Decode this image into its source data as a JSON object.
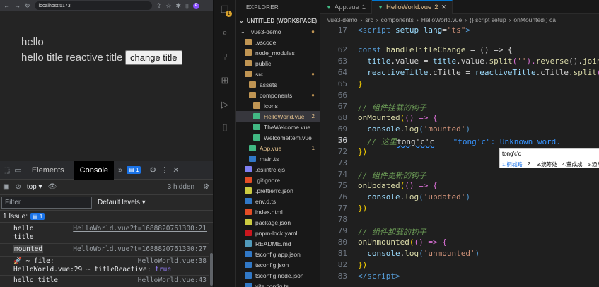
{
  "browser": {
    "url": "localhost:5173",
    "profile_letter": "P",
    "page": {
      "line1": "hello",
      "line2": "hello title reactive title",
      "button_label": "change title"
    }
  },
  "devtools": {
    "tabs": [
      "Elements",
      "Console"
    ],
    "active_tab": "Console",
    "issue_badge": "1",
    "context": "top",
    "hidden_count": "3 hidden",
    "filter_placeholder": "Filter",
    "levels": "Default levels ▾",
    "issues_label": "1 Issue:",
    "issues_count": "1",
    "logs": [
      {
        "msg1": "hello",
        "msg2": "title",
        "src": "HelloWorld.vue?t=1688820761300:21"
      },
      {
        "msg1": "mounted",
        "src": "HelloWorld.vue?t=1688820761300:27"
      },
      {
        "msg1": "🚀 ~ file:",
        "msg2": "HelloWorld.vue:29 ~ titleReactive:",
        "value": "true",
        "src": "HelloWorld.vue:38"
      },
      {
        "msg1": "hello title",
        "src": "HelloWorld.vue:43"
      }
    ]
  },
  "vscode": {
    "explorer_title": "EXPLORER",
    "workspace": "UNTITLED (WORKSPACE)",
    "notification_count": "1",
    "tree": [
      {
        "name": "vue3-demo",
        "kind": "root",
        "status": "●"
      },
      {
        "name": ".vscode",
        "kind": "folder"
      },
      {
        "name": "node_modules",
        "kind": "folder"
      },
      {
        "name": "public",
        "kind": "folder"
      },
      {
        "name": "src",
        "kind": "folder",
        "status": "●"
      },
      {
        "name": "assets",
        "kind": "folder"
      },
      {
        "name": "components",
        "kind": "folder",
        "status": "●"
      },
      {
        "name": "icons",
        "kind": "folder"
      },
      {
        "name": "HelloWorld.vue",
        "kind": "vue",
        "status": "2",
        "selected": true
      },
      {
        "name": "TheWelcome.vue",
        "kind": "vue"
      },
      {
        "name": "WelcomeItem.vue",
        "kind": "vue"
      },
      {
        "name": "App.vue",
        "kind": "vue",
        "status": "1"
      },
      {
        "name": "main.ts",
        "kind": "ts"
      },
      {
        "name": ".eslintrc.cjs",
        "kind": "eslint"
      },
      {
        "name": ".gitignore",
        "kind": "git"
      },
      {
        "name": ".prettierrc.json",
        "kind": "json"
      },
      {
        "name": "env.d.ts",
        "kind": "ts"
      },
      {
        "name": "index.html",
        "kind": "html"
      },
      {
        "name": "package.json",
        "kind": "json"
      },
      {
        "name": "pnpm-lock.yaml",
        "kind": "yaml"
      },
      {
        "name": "README.md",
        "kind": "md"
      },
      {
        "name": "tsconfig.app.json",
        "kind": "ts"
      },
      {
        "name": "tsconfig.json",
        "kind": "ts"
      },
      {
        "name": "tsconfig.node.json",
        "kind": "ts"
      },
      {
        "name": "vite.config.ts",
        "kind": "ts"
      }
    ],
    "tabs": [
      {
        "name": "App.vue",
        "status": "1"
      },
      {
        "name": "HelloWorld.vue",
        "status": "2",
        "active": true
      }
    ],
    "breadcrumb": [
      "vue3-demo",
      "src",
      "components",
      "HelloWorld.vue",
      "{} script setup",
      "onMounted() ca"
    ],
    "line_numbers": [
      "17",
      "",
      "62",
      "63",
      "64",
      "65",
      "66",
      "67",
      "68",
      "69",
      "70",
      "56",
      "72",
      "73",
      "74",
      "75",
      "76",
      "77",
      "78",
      "79",
      "80",
      "81",
      "82"
    ],
    "current_line": "56",
    "code": {
      "l1_a": "<",
      "l1_b": "script",
      "l1_c": " setup",
      "l1_d": " lang",
      "l1_e": "=",
      "l1_f": "\"ts\"",
      "l1_g": ">",
      "l3_a": "const",
      "l3_b": " handleTitleChange",
      "l3_c": " = () => {",
      "l4_a": "title",
      "l4_b": ".value = ",
      "l4_c": "title",
      "l4_d": ".value.",
      "l4_e": "split",
      "l4_f": "(",
      "l4_g": "''",
      "l4_h": ").",
      "l4_i": "reverse",
      "l4_j": "().",
      "l4_k": "join",
      "l5_a": "reactiveTitle",
      "l5_b": ".cTitle = ",
      "l5_c": "reactiveTitle",
      "l5_d": ".cTitle.",
      "l5_e": "split",
      "l5_f": "(",
      "l6": "}",
      "l8": "// 组件挂载的钩子",
      "l9_a": "onMounted",
      "l9_b": "(",
      "l9_c": "() => {",
      "l10_a": "console",
      "l10_b": ".",
      "l10_c": "log",
      "l10_d": "(",
      "l10_e": "'mounted'",
      "l10_f": ")",
      "l11_a": "// 这里",
      "l11_b": "tong'c'c",
      "l11_hint": "\"tong'c\": Unknown word.",
      "l12": "})",
      "l14": "// 组件更新的钩子",
      "l15_a": "onUpdated",
      "l15_b": "(",
      "l15_c": "() => {",
      "l16_a": "console",
      "l16_b": ".",
      "l16_c": "log",
      "l16_d": "(",
      "l16_e": "'updated'",
      "l16_f": ")",
      "l17": "})",
      "l19": "// 组件卸载的钩子",
      "l20_a": "onUnmounted",
      "l20_b": "(",
      "l20_c": "() => {",
      "l21_a": "console",
      "l21_b": ".",
      "l21_c": "log",
      "l21_d": "(",
      "l21_e": "'unmounted'",
      "l21_f": ")",
      "l22": "})",
      "l23_a": "</",
      "l23_b": "script",
      "l23_c": ">"
    },
    "ime": {
      "composition": "tong'c'c",
      "candidates": [
        "1.桐城路",
        "2.",
        "3.统筹处",
        "4.董成成",
        "5.通常从"
      ],
      "arrows": "‹ ›"
    }
  },
  "colors": {
    "accent": "#0078d4",
    "vue_green": "#41b883",
    "badge_blue": "#1a73e8"
  }
}
